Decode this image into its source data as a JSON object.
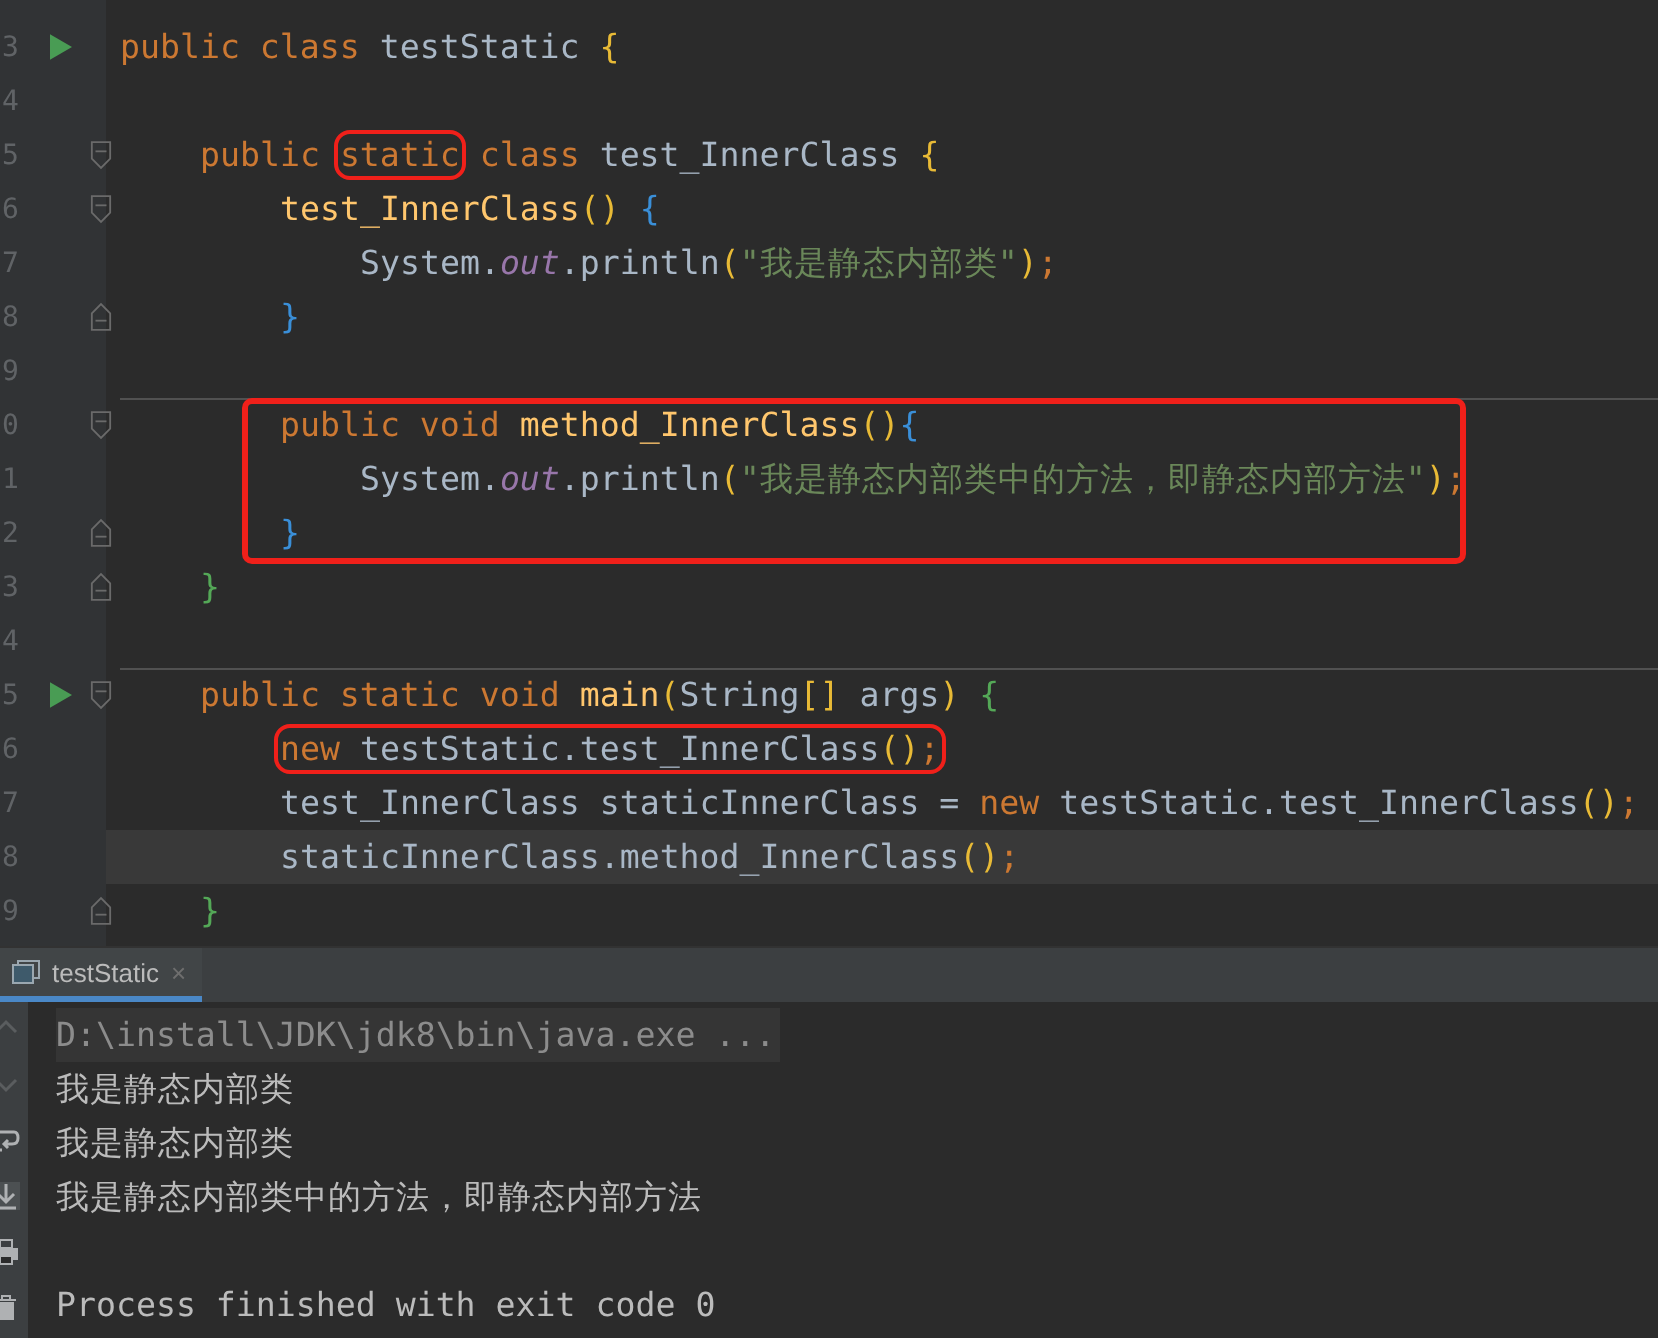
{
  "editor": {
    "lines": [
      {
        "number": "3",
        "run": true,
        "tokens": [
          {
            "text": "public class ",
            "kind": "kw"
          },
          {
            "text": "testStatic ",
            "kind": "id"
          },
          {
            "text": "{",
            "kind": "br1"
          }
        ],
        "children": [
          {
            "number": "4"
          },
          {
            "number": "5",
            "fold_start": true,
            "tokens": [
              {
                "text": "public ",
                "kind": "kw"
              },
              {
                "kind": "boxed",
                "tokens": [
                  {
                    "text": "static",
                    "kind": "kw"
                  }
                ]
              },
              {
                "text": " class ",
                "kind": "kw"
              },
              {
                "text": "test_InnerClass ",
                "kind": "id"
              },
              {
                "text": "{",
                "kind": "br1"
              }
            ],
            "children": [
              {
                "number": "6",
                "fold_start": true,
                "tokens": [
                  {
                    "text": "test_InnerClass",
                    "kind": "decl"
                  },
                  {
                    "text": "() ",
                    "kind": "br1"
                  },
                  {
                    "text": "{",
                    "kind": "br2"
                  }
                ],
                "children": [
                  {
                    "number": "7",
                    "tokens": [
                      {
                        "text": "System.",
                        "kind": "id"
                      },
                      {
                        "text": "out",
                        "kind": "field"
                      },
                      {
                        "text": ".println",
                        "kind": "id"
                      },
                      {
                        "text": "(",
                        "kind": "br1"
                      },
                      {
                        "text": "\"我是静态内部类\"",
                        "kind": "str"
                      },
                      {
                        "text": ")",
                        "kind": "br1"
                      },
                      {
                        "text": ";",
                        "kind": "kw"
                      }
                    ]
                  }
                ]
              },
              {
                "number": "8",
                "fold_end": true,
                "tokens": [
                  {
                    "text": "}",
                    "kind": "br2"
                  }
                ]
              },
              {
                "number": "9"
              },
              {
                "kind": "boxed",
                "lines": [
                  {
                    "number": "0",
                    "fold_start": true,
                    "separator": true,
                    "tokens": [
                      {
                        "text": "public void ",
                        "kind": "kw"
                      },
                      {
                        "text": "method_InnerClass",
                        "kind": "decl"
                      },
                      {
                        "text": "()",
                        "kind": "br1"
                      },
                      {
                        "text": "{",
                        "kind": "br2"
                      }
                    ],
                    "children": [
                      {
                        "number": "1",
                        "tokens": [
                          {
                            "text": "System.",
                            "kind": "id"
                          },
                          {
                            "text": "out",
                            "kind": "field"
                          },
                          {
                            "text": ".println",
                            "kind": "id"
                          },
                          {
                            "text": "(",
                            "kind": "br1"
                          },
                          {
                            "text": "\"我是静态内部类中的方法，即静态内部方法\"",
                            "kind": "str"
                          },
                          {
                            "text": ")",
                            "kind": "br1"
                          },
                          {
                            "text": ";",
                            "kind": "kw"
                          }
                        ]
                      }
                    ]
                  },
                  {
                    "number": "2",
                    "fold_end": true,
                    "tokens": [
                      {
                        "text": "}",
                        "kind": "br2"
                      }
                    ]
                  }
                ]
              }
            ]
          },
          {
            "number": "3",
            "fold_end": true,
            "tokens": [
              {
                "text": "}",
                "kind": "br3"
              }
            ]
          },
          {
            "number": "4"
          },
          {
            "number": "5",
            "run": true,
            "fold_start": true,
            "separator": true,
            "tokens": [
              {
                "text": "public static void ",
                "kind": "kw"
              },
              {
                "text": "main",
                "kind": "decl"
              },
              {
                "text": "(",
                "kind": "br1"
              },
              {
                "text": "String",
                "kind": "id"
              },
              {
                "text": "[]",
                "kind": "br1"
              },
              {
                "text": " args",
                "kind": "id"
              },
              {
                "text": ") ",
                "kind": "br1"
              },
              {
                "text": "{",
                "kind": "br3"
              }
            ],
            "children": [
              {
                "number": "6",
                "tokens": [
                  {
                    "kind": "boxed",
                    "tokens": [
                      {
                        "text": "new ",
                        "kind": "kw"
                      },
                      {
                        "text": "testStatic.test_InnerClass",
                        "kind": "id"
                      },
                      {
                        "text": "()",
                        "kind": "br1"
                      },
                      {
                        "text": ";",
                        "kind": "kw"
                      }
                    ]
                  }
                ]
              },
              {
                "number": "7",
                "tokens": [
                  {
                    "text": "test_InnerClass staticInnerClass = ",
                    "kind": "id"
                  },
                  {
                    "text": "new ",
                    "kind": "kw"
                  },
                  {
                    "text": "testStatic.test_InnerClass",
                    "kind": "id"
                  },
                  {
                    "text": "()",
                    "kind": "br1"
                  },
                  {
                    "text": ";",
                    "kind": "kw"
                  }
                ]
              },
              {
                "number": "8",
                "current": true,
                "tokens": [
                  {
                    "text": "staticInnerClass.method_InnerClass",
                    "kind": "id"
                  },
                  {
                    "text": "()",
                    "kind": "br1"
                  },
                  {
                    "text": ";",
                    "kind": "kw"
                  }
                ]
              }
            ]
          },
          {
            "number": "9",
            "fold_end": true,
            "tokens": [
              {
                "text": "}",
                "kind": "br3"
              }
            ]
          }
        ]
      }
    ]
  },
  "run_panel": {
    "tab": {
      "label": "testStatic",
      "close": "×",
      "selected": true
    },
    "output": [
      {
        "text": "D:\\install\\JDK\\jdk8\\bin\\java.exe ...",
        "kind": "command"
      },
      {
        "text": "我是静态内部类",
        "kind": "out"
      },
      {
        "text": "我是静态内部类",
        "kind": "out"
      },
      {
        "text": "我是静态内部类中的方法，即静态内部方法",
        "kind": "out"
      },
      {
        "kind": "blank"
      },
      {
        "text": "Process finished with exit code 0",
        "kind": "out"
      }
    ]
  }
}
